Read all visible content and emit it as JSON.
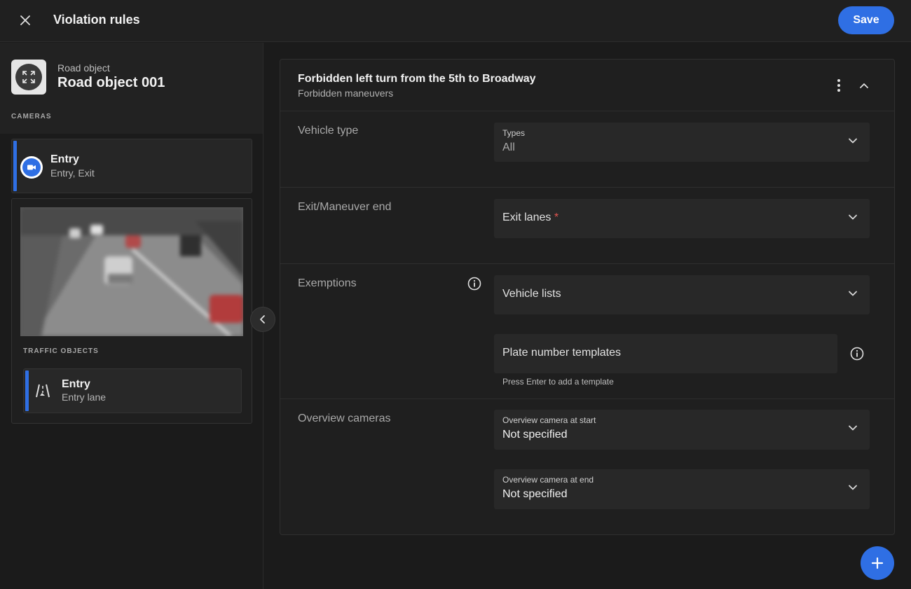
{
  "header": {
    "title": "Violation rules",
    "save_label": "Save"
  },
  "sidebar": {
    "object_caption": "Road object",
    "object_name": "Road object 001",
    "cameras_label": "CAMERAS",
    "camera": {
      "title": "Entry",
      "subtitle": "Entry, Exit"
    },
    "traffic_objects_label": "TRAFFIC OBJECTS",
    "lane": {
      "title": "Entry",
      "subtitle": "Entry lane"
    }
  },
  "rule": {
    "title": "Forbidden left turn from the 5th to Broadway",
    "subtitle": "Forbidden maneuvers",
    "vehicle_type": {
      "label": "Vehicle type",
      "field_label": "Types",
      "value": "All"
    },
    "exit": {
      "label": "Exit/Maneuver end",
      "field_label": "Exit lanes",
      "required_mark": "*"
    },
    "exemptions": {
      "label": "Exemptions",
      "vehicle_lists": "Vehicle lists",
      "plate_templates": "Plate number templates",
      "helper": "Press Enter to add a template"
    },
    "overview": {
      "label": "Overview cameras",
      "start_label": "Overview camera at start",
      "start_value": "Not specified",
      "end_label": "Overview camera at end",
      "end_value": "Not specified"
    }
  },
  "colors": {
    "accent": "#2f6fe4",
    "required": "#e2554f"
  },
  "icons": [
    "close-icon",
    "fullscreen-icon",
    "camera-icon",
    "lane-icon",
    "chevron-left-icon",
    "more-vert-icon",
    "chevron-up-icon",
    "chevron-down-icon",
    "info-icon",
    "plus-icon"
  ]
}
